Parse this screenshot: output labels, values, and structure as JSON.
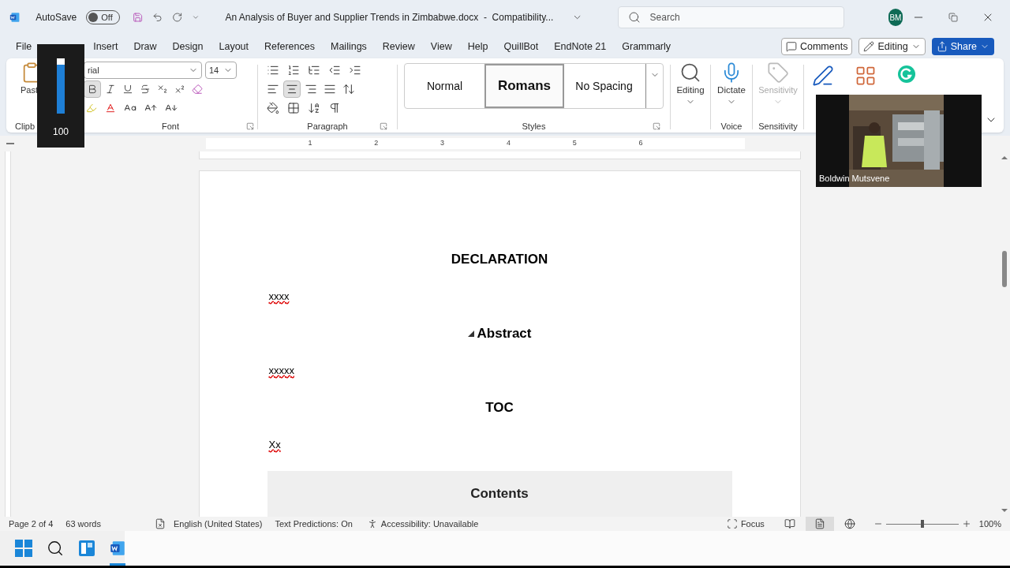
{
  "title_bar": {
    "autosave_label": "AutoSave",
    "autosave_on": false,
    "autosave_state": "Off",
    "document_title": "An Analysis of Buyer and Supplier Trends in Zimbabwe.docx  -  Compatibility...",
    "search_placeholder": "Search",
    "user_initials": "BM"
  },
  "menu_tabs": [
    {
      "label": "File",
      "selected": false
    },
    {
      "label": "Insert",
      "selected": false
    },
    {
      "label": "Draw",
      "selected": false
    },
    {
      "label": "Design",
      "selected": false
    },
    {
      "label": "Layout",
      "selected": false
    },
    {
      "label": "References",
      "selected": false
    },
    {
      "label": "Mailings",
      "selected": false
    },
    {
      "label": "Review",
      "selected": false
    },
    {
      "label": "View",
      "selected": false
    },
    {
      "label": "Help",
      "selected": false
    },
    {
      "label": "QuillBot",
      "selected": false
    },
    {
      "label": "EndNote 21",
      "selected": false
    },
    {
      "label": "Grammarly",
      "selected": false
    }
  ],
  "header_buttons": {
    "comments": "Comments",
    "editing": "Editing",
    "share": "Share"
  },
  "ribbon": {
    "clipboard": {
      "paste_label": "Past",
      "group_label": "Clipb"
    },
    "font": {
      "name": "rial",
      "size": "14",
      "group_label": "Font",
      "bold_on": true
    },
    "paragraph": {
      "group_label": "Paragraph",
      "alignments": [
        {
          "kind": "left",
          "selected": false
        },
        {
          "kind": "center",
          "selected": true
        },
        {
          "kind": "right",
          "selected": false
        },
        {
          "kind": "justify",
          "selected": false
        }
      ]
    },
    "styles": {
      "group_label": "Styles",
      "items": [
        {
          "label": "Normal",
          "selected": false
        },
        {
          "label": "Romans",
          "selected": true
        },
        {
          "label": "No Spacing",
          "selected": false
        }
      ]
    },
    "editing": {
      "label": "Editing"
    },
    "voice": {
      "button": "Dictate",
      "group_label": "Voice"
    },
    "sensitivity": {
      "button": "Sensitivity",
      "disabled": true,
      "group_label": "Sensitivity"
    }
  },
  "volume_popup": {
    "level": 0.88,
    "reading": "100"
  },
  "video_overlay": {
    "participant": "Boldwin Mutsvene"
  },
  "ruler": {
    "ticks": [
      "1",
      "2",
      "3",
      "4",
      "5",
      "6"
    ]
  },
  "document": {
    "blocks": [
      {
        "kind": "heading",
        "text": "DECLARATION"
      },
      {
        "kind": "para",
        "text": "xxxx",
        "misspelled": true
      },
      {
        "kind": "heading",
        "text": "Abstract",
        "collapsible": true
      },
      {
        "kind": "para",
        "text": "xxxxx",
        "misspelled": true
      },
      {
        "kind": "heading",
        "text": "TOC"
      },
      {
        "kind": "para",
        "text": "Xx",
        "misspelled": true
      },
      {
        "kind": "toc_heading",
        "text": "Contents"
      }
    ]
  },
  "status_bar": {
    "page": "Page 2 of 4",
    "words": "63 words",
    "language": "English (United States)",
    "predictions": "Text Predictions: On",
    "accessibility": "Accessibility: Unavailable",
    "focus": "Focus",
    "views": [
      {
        "kind": "read",
        "selected": false
      },
      {
        "kind": "print",
        "selected": true
      },
      {
        "kind": "web",
        "selected": false
      }
    ],
    "zoom": {
      "level": 0.5,
      "reading": "100%"
    }
  },
  "taskbar": {
    "apps": [
      {
        "kind": "start",
        "active": false
      },
      {
        "kind": "search",
        "active": false
      },
      {
        "kind": "widgets",
        "active": false
      },
      {
        "kind": "word",
        "active": true
      }
    ]
  }
}
